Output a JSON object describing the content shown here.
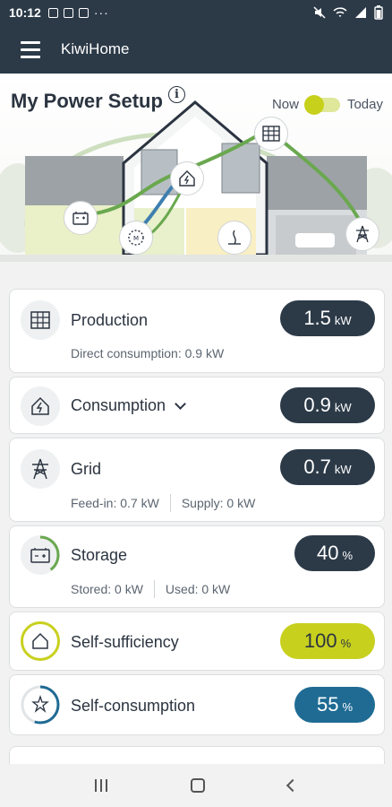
{
  "status_bar": {
    "time": "10:12",
    "more": "···"
  },
  "app_bar": {
    "title": "KiwiHome"
  },
  "hero": {
    "title": "My Power Setup",
    "info_glyph": "i",
    "toggle_left": "Now",
    "toggle_right": "Today",
    "toggle_state": "Now"
  },
  "cards": {
    "production": {
      "label": "Production",
      "value": "1.5",
      "unit": "kW",
      "sub": "Direct consumption: 0.9 kW",
      "icon": "solar-panel-icon"
    },
    "consumption": {
      "label": "Consumption",
      "value": "0.9",
      "unit": "kW",
      "icon": "house-plug-icon"
    },
    "grid": {
      "label": "Grid",
      "value": "0.7",
      "unit": "kW",
      "sub1": "Feed-in: 0.7 kW",
      "sub2": "Supply: 0 kW",
      "icon": "pylon-icon"
    },
    "storage": {
      "label": "Storage",
      "value": "40",
      "unit": "%",
      "sub1": "Stored: 0 kW",
      "sub2": "Used: 0 kW",
      "icon": "battery-icon",
      "level_percent": 40
    },
    "self_sufficiency": {
      "label": "Self-sufficiency",
      "value": "100",
      "unit": "%",
      "icon": "house-ring-icon",
      "level_percent": 100
    },
    "self_consumption": {
      "label": "Self-consumption",
      "value": "55",
      "unit": "%",
      "icon": "star-hand-icon",
      "level_percent": 55
    }
  },
  "colors": {
    "dark": "#2c3a48",
    "accent_yellow": "#c8d01e",
    "accent_blue": "#1f6b94",
    "flow_green": "#6aa84f",
    "flow_blue": "#3f7fb0"
  }
}
